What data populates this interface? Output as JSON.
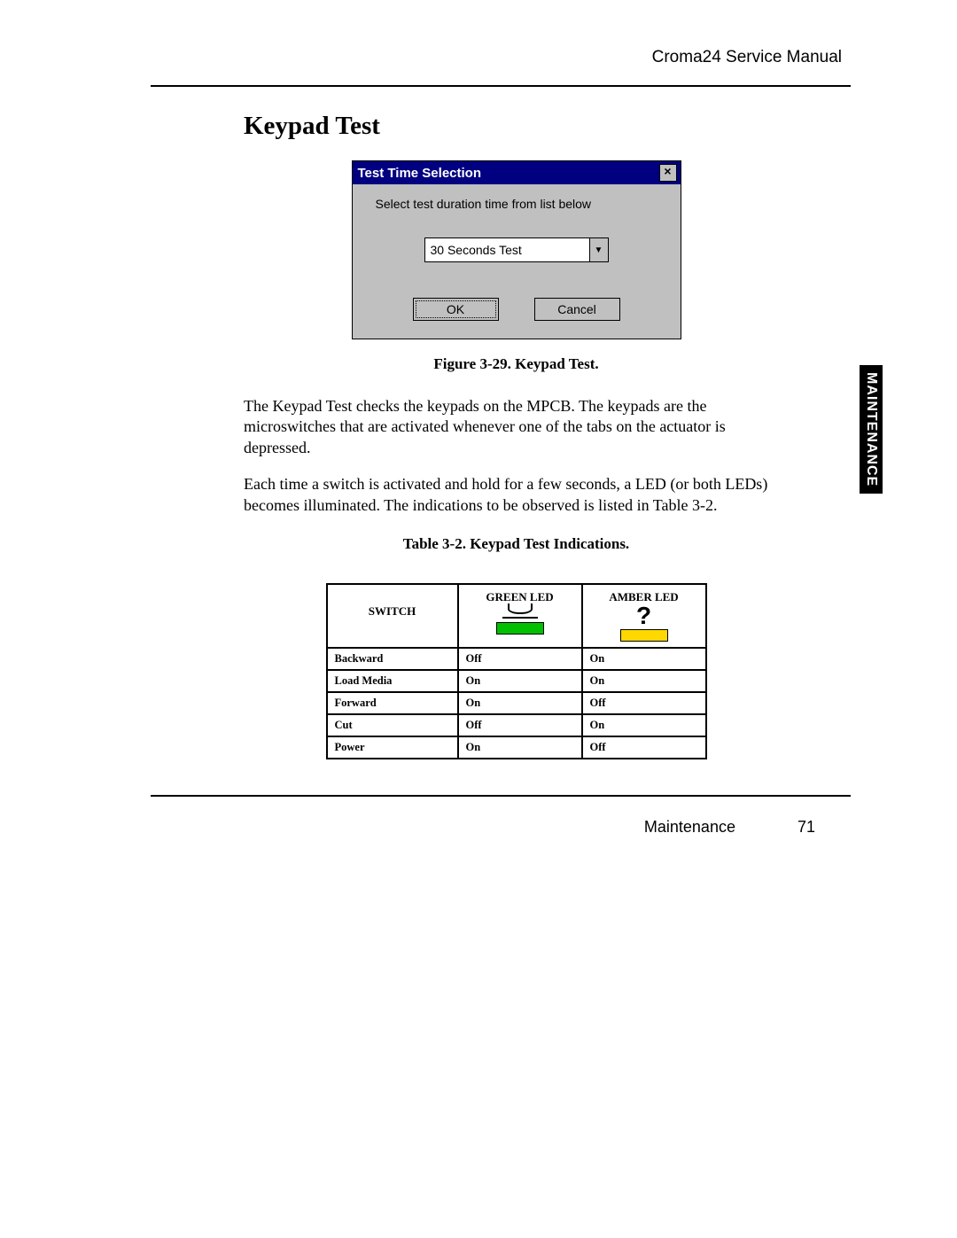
{
  "header": {
    "doc_title": "Croma24 Service Manual"
  },
  "heading": "Keypad Test",
  "dialog": {
    "title": "Test Time Selection",
    "close_glyph": "×",
    "instruction": "Select test duration time from list below",
    "selected_option": "30 Seconds Test",
    "ok_label": "OK",
    "cancel_label": "Cancel"
  },
  "figure_caption": "Figure 3-29.  Keypad Test.",
  "para1": "The Keypad Test checks the keypads on the MPCB. The keypads are the microswitches that are activated whenever one of the tabs on the actuator is depressed.",
  "para2": "Each time a switch is activated and hold for a few seconds, a LED (or both LEDs) becomes illuminated. The indications to be observed is listed in Table 3-2.",
  "table_caption": "Table 3-2.   Keypad Test Indications.",
  "side_tab": "MAINTENANCE",
  "table": {
    "headers": {
      "switch": "SWITCH",
      "green": "GREEN LED",
      "amber": "AMBER LED"
    },
    "rows": [
      {
        "switch": "Backward",
        "green": "Off",
        "amber": "On"
      },
      {
        "switch": "Load Media",
        "green": "On",
        "amber": "On"
      },
      {
        "switch": "Forward",
        "green": "On",
        "amber": "Off"
      },
      {
        "switch": "Cut",
        "green": "Off",
        "amber": "On"
      },
      {
        "switch": "Power",
        "green": "On",
        "amber": "Off"
      }
    ]
  },
  "footer": {
    "section": "Maintenance",
    "page_number": "71"
  }
}
